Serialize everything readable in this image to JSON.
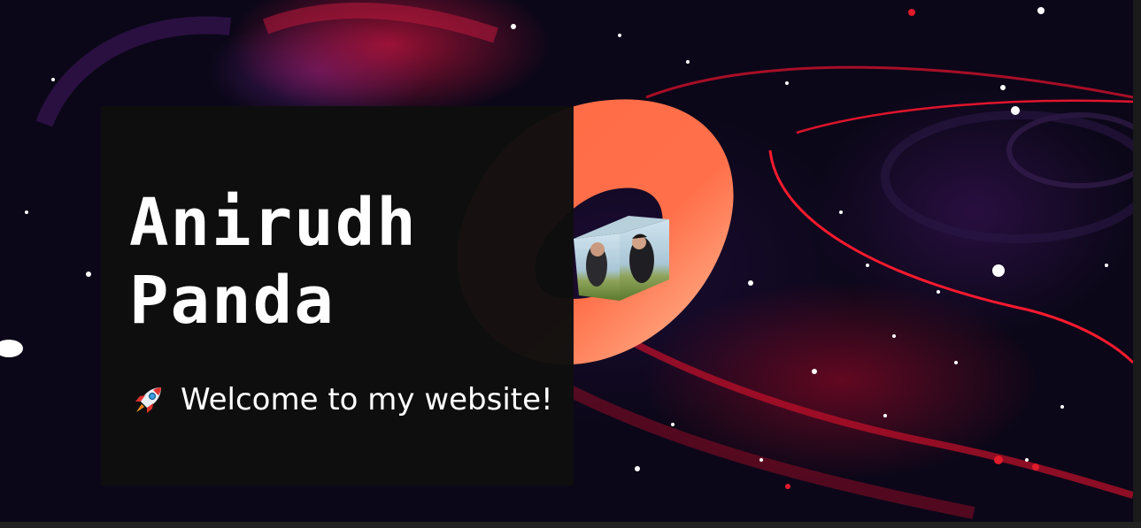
{
  "hero": {
    "name_line1": "Anirudh",
    "name_line2": "Panda",
    "welcome_text": "Welcome to my website!",
    "welcome_icon": "rocket-icon"
  },
  "colors": {
    "card_background": "#0e0e0e",
    "torus": "#ff6b47",
    "space_accent": "#e0102a",
    "text": "#ffffff"
  }
}
